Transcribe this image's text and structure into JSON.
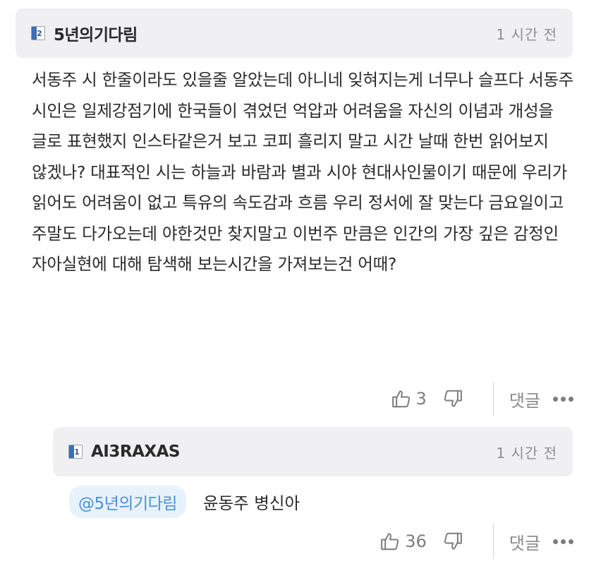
{
  "comment": {
    "level": "2",
    "nickname": "5년의기다림",
    "time": "1 시간 전",
    "text": "서동주 시 한줄이라도 있을줄 알았는데 아니네 잊혀지는게 너무나 슬프다 서동주 시인은 일제강점기에 한국들이 겪었던 억압과 어려움을 자신의 이념과 개성을 글로 표현했지 인스타같은거 보고 코피 흘리지 말고 시간 날때 한번 읽어보지 않겠나? 대표적인 시는 하늘과 바람과 별과 시야 현대사인물이기 때문에 우리가 읽어도 어려움이 없고 특유의 속도감과 흐름 우리 정서에 잘 맞는다 금요일이고 주말도 다가오는데 야한것만 찾지말고 이번주 만큼은 인간의 가장 깊은 감정인 자아실현에 대해 탐색해 보는시간을 가져보는건 어때?",
    "likes": "3",
    "reply_label": "댓글"
  },
  "reply": {
    "level": "1",
    "nickname": "AI3RAXAS",
    "time": "1 시간 전",
    "mention": "@5년의기다림",
    "text": "윤동주 병신아",
    "likes": "36",
    "reply_label": "댓글"
  },
  "icons": {
    "like": "thumbs-up-icon",
    "dislike": "thumbs-down-icon",
    "more": "more-dots-icon",
    "level_badge": "level-badge-icon"
  },
  "colors": {
    "header_bg": "#f0f0f2",
    "mention_text": "#4a90d9",
    "mention_bg": "#e8f2fb"
  }
}
